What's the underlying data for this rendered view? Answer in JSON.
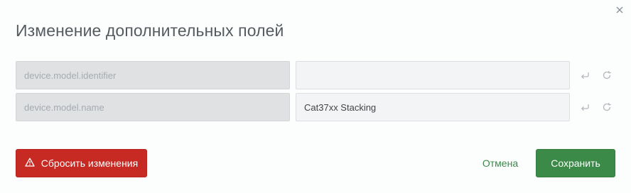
{
  "dialog": {
    "title": "Изменение дополнительных полей",
    "close_icon": "close-icon"
  },
  "fields": [
    {
      "key": "device.model.identifier",
      "value": "",
      "icons": [
        "undo-icon",
        "refresh-icon"
      ]
    },
    {
      "key": "device.model.name",
      "value": "Cat37xx Stacking",
      "icons": [
        "undo-icon",
        "refresh-icon"
      ]
    }
  ],
  "actions": {
    "reset_label": "Сбросить изменения",
    "reset_icon": "warning-icon",
    "cancel_label": "Отмена",
    "save_label": "Сохранить"
  },
  "colors": {
    "danger": "#c62a23",
    "primary": "#3b8a47",
    "link": "#3a8a4a",
    "title": "#555b61"
  }
}
